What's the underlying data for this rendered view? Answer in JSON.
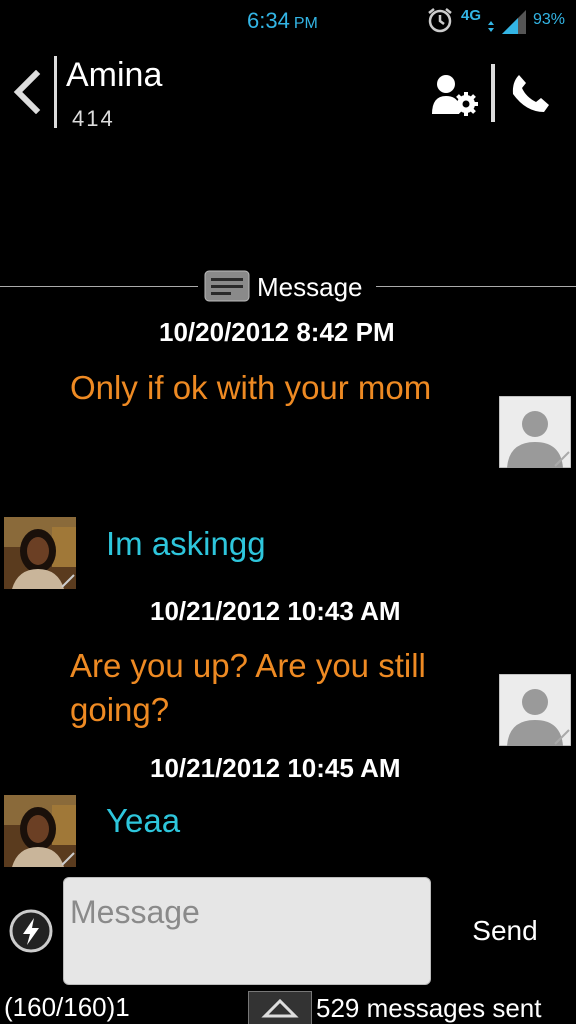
{
  "status_bar": {
    "time": "6:34",
    "ampm": "PM",
    "network": "4G",
    "battery": "93%",
    "icons": [
      "alarm-icon",
      "network-4g-icon",
      "signal-icon"
    ],
    "accent_color": "#33b5e5"
  },
  "header": {
    "contact_name": "Amina",
    "contact_number": "414",
    "icons": [
      "back-icon",
      "contact-settings-icon",
      "call-icon"
    ]
  },
  "separator": {
    "label": "Message",
    "icon": "message-icon"
  },
  "messages": [
    {
      "type": "timestamp",
      "text": "10/20/2012 8:42 PM"
    },
    {
      "type": "sent",
      "text": "Only if ok with your mom"
    },
    {
      "type": "received",
      "text": "Im askingg"
    },
    {
      "type": "timestamp",
      "text": "10/21/2012 10:43 AM"
    },
    {
      "type": "sent",
      "text": "Are you up? Are you still going?"
    },
    {
      "type": "timestamp",
      "text": "10/21/2012 10:45 AM"
    },
    {
      "type": "received",
      "text": "Yeaa"
    }
  ],
  "colors": {
    "sent_text": "#ee8a23",
    "received_text": "#2ec6dc",
    "background": "#000000"
  },
  "composer": {
    "placeholder": "Message",
    "send_label": "Send",
    "char_counter": "(160/160)1",
    "messages_sent": "529 messages sent",
    "icons": [
      "quick-action-icon",
      "expand-up-icon"
    ]
  }
}
